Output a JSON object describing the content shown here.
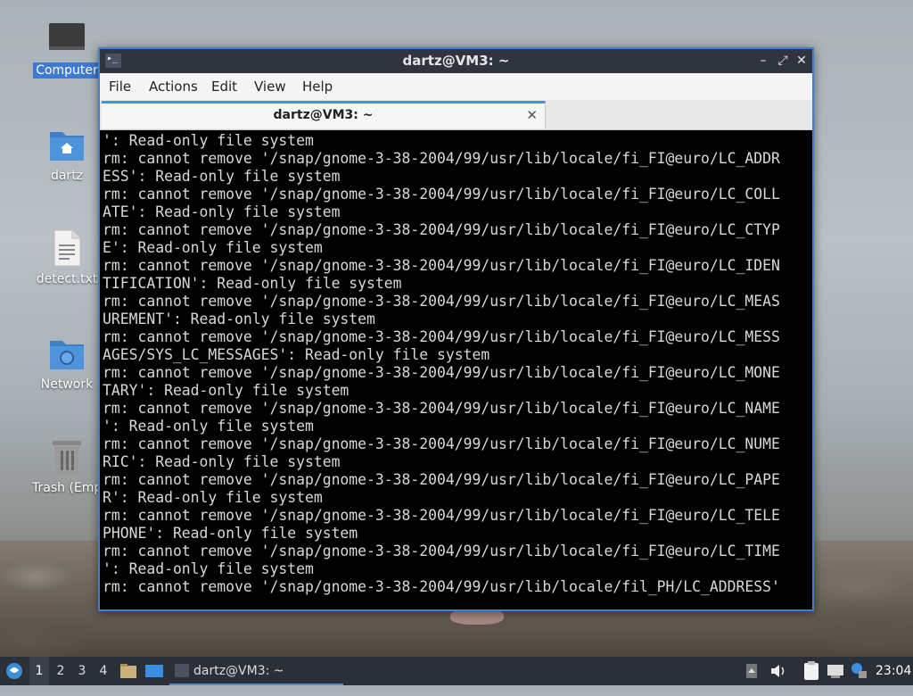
{
  "desktop": {
    "icons": [
      {
        "label": "Computer",
        "icon": "computer-icon"
      },
      {
        "label": "dartz",
        "icon": "home-folder-icon"
      },
      {
        "label": "detect.txt",
        "icon": "text-file-icon"
      },
      {
        "label": "Network",
        "icon": "network-folder-icon"
      },
      {
        "label": "Trash (Empt",
        "icon": "trash-icon"
      }
    ]
  },
  "window": {
    "title": "dartz@VM3: ~",
    "menu": [
      "File",
      "Actions",
      "Edit",
      "View",
      "Help"
    ],
    "tab_title": "dartz@VM3: ~",
    "terminal_lines": [
      "': Read-only file system",
      "rm: cannot remove '/snap/gnome-3-38-2004/99/usr/lib/locale/fi_FI@euro/LC_ADDR",
      "ESS': Read-only file system",
      "rm: cannot remove '/snap/gnome-3-38-2004/99/usr/lib/locale/fi_FI@euro/LC_COLL",
      "ATE': Read-only file system",
      "rm: cannot remove '/snap/gnome-3-38-2004/99/usr/lib/locale/fi_FI@euro/LC_CTYP",
      "E': Read-only file system",
      "rm: cannot remove '/snap/gnome-3-38-2004/99/usr/lib/locale/fi_FI@euro/LC_IDEN",
      "TIFICATION': Read-only file system",
      "rm: cannot remove '/snap/gnome-3-38-2004/99/usr/lib/locale/fi_FI@euro/LC_MEAS",
      "UREMENT': Read-only file system",
      "rm: cannot remove '/snap/gnome-3-38-2004/99/usr/lib/locale/fi_FI@euro/LC_MESS",
      "AGES/SYS_LC_MESSAGES': Read-only file system",
      "rm: cannot remove '/snap/gnome-3-38-2004/99/usr/lib/locale/fi_FI@euro/LC_MONE",
      "TARY': Read-only file system",
      "rm: cannot remove '/snap/gnome-3-38-2004/99/usr/lib/locale/fi_FI@euro/LC_NAME",
      "': Read-only file system",
      "rm: cannot remove '/snap/gnome-3-38-2004/99/usr/lib/locale/fi_FI@euro/LC_NUME",
      "RIC': Read-only file system",
      "rm: cannot remove '/snap/gnome-3-38-2004/99/usr/lib/locale/fi_FI@euro/LC_PAPE",
      "R': Read-only file system",
      "rm: cannot remove '/snap/gnome-3-38-2004/99/usr/lib/locale/fi_FI@euro/LC_TELE",
      "PHONE': Read-only file system",
      "rm: cannot remove '/snap/gnome-3-38-2004/99/usr/lib/locale/fi_FI@euro/LC_TIME",
      "': Read-only file system",
      "rm: cannot remove '/snap/gnome-3-38-2004/99/usr/lib/locale/fil_PH/LC_ADDRESS'"
    ]
  },
  "taskbar": {
    "workspaces": [
      "1",
      "2",
      "3",
      "4"
    ],
    "active_workspace": "1",
    "task_label": "dartz@VM3: ~",
    "clock": "23:04"
  },
  "colors": {
    "accent": "#4a90d9",
    "titlebar": "#2f343f",
    "taskbar": "#2b2f38",
    "terminal_bg": "#000000",
    "terminal_fg": "#d8d8d8"
  }
}
